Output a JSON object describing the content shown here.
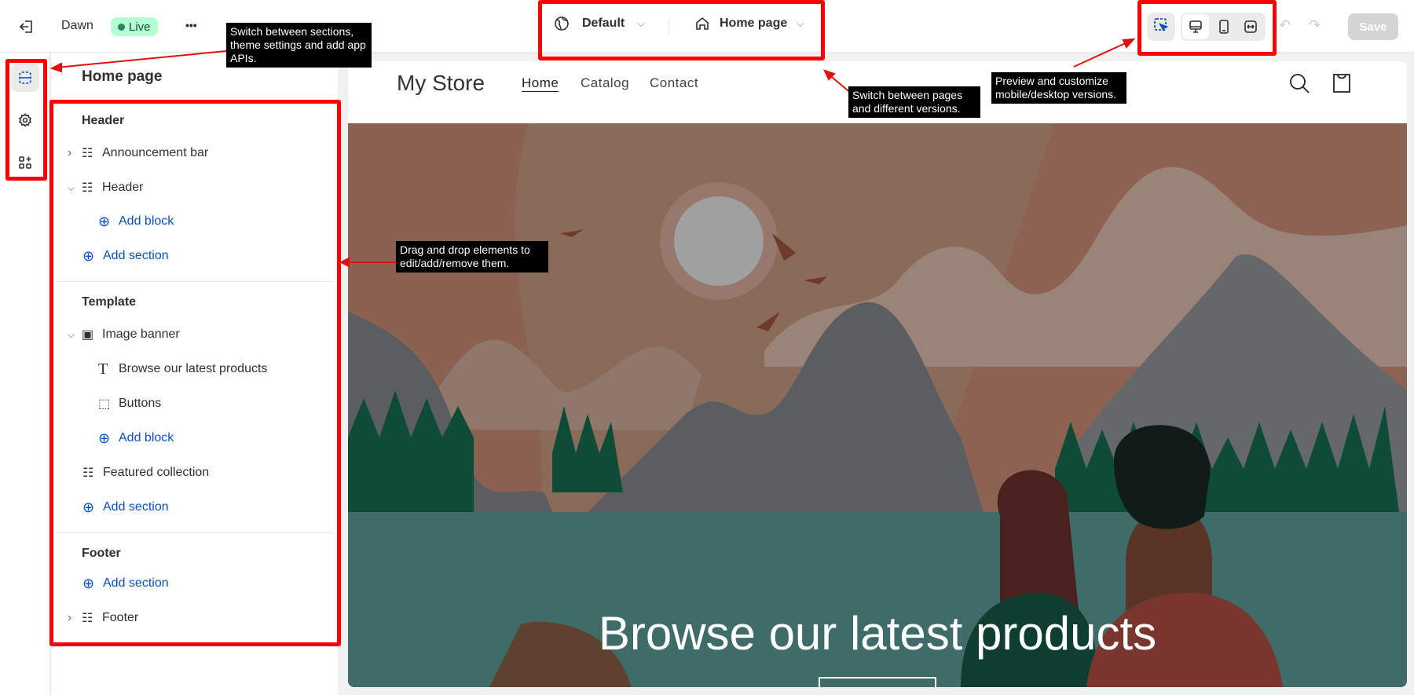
{
  "topbar": {
    "theme_name": "Dawn",
    "status": "Live",
    "more": "•••",
    "market": "Default",
    "page": "Home page",
    "save": "Save"
  },
  "panel": {
    "title": "Home page",
    "header_label": "Header",
    "announcement": "Announcement bar",
    "header_item": "Header",
    "add_block": "Add block",
    "add_section": "Add section",
    "template_label": "Template",
    "image_banner": "Image banner",
    "browse": "Browse our latest products",
    "buttons": "Buttons",
    "featured": "Featured collection",
    "footer_label": "Footer",
    "footer_item": "Footer"
  },
  "preview": {
    "store_name": "My Store",
    "nav": [
      "Home",
      "Catalog",
      "Contact"
    ],
    "banner_heading": "Browse our latest products"
  },
  "annotations": {
    "rail": "Switch between sections, theme settings and add app APIs.",
    "pages": "Switch between pages and different versions.",
    "preview": "Preview and customize mobile/desktop versions.",
    "drag": "Drag and drop elements to edit/add/remove them."
  },
  "colors": {
    "accent": "#0b4fc4",
    "annotation": "#ff0000",
    "live": "#b4fed2"
  }
}
